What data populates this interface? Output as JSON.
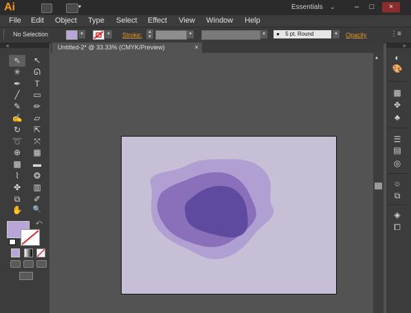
{
  "app": {
    "logo": "Ai",
    "workspace": "Essentials"
  },
  "menu": [
    "File",
    "Edit",
    "Object",
    "Type",
    "Select",
    "Effect",
    "View",
    "Window",
    "Help"
  ],
  "control": {
    "selection": "No Selection",
    "stroke_label": "Stroke:",
    "brush": "5 pt. Round",
    "opacity_label": "Opacity"
  },
  "document": {
    "tab_title": "Untitled-2* @ 33.33% (CMYK/Preview)",
    "close": "×"
  },
  "window_buttons": {
    "minimize": "–",
    "maximize": "□",
    "close": "×"
  },
  "colors": {
    "accent": "#e69b2a",
    "fill_swatch": "#b8a6d9",
    "artboard": "#c7bfd6",
    "shape_outer": "#b09fd3",
    "shape_mid": "#8a6fbb",
    "shape_inner": "#5e4a9e"
  },
  "icons": {
    "tools": [
      "selection-tool",
      "direct-selection-tool",
      "magic-wand-tool",
      "lasso-tool",
      "pen-tool",
      "type-tool",
      "line-tool",
      "rectangle-tool",
      "paintbrush-tool",
      "pencil-tool",
      "blob-brush-tool",
      "eraser-tool",
      "rotate-tool",
      "scale-tool",
      "warp-tool",
      "free-transform-tool",
      "shape-builder-tool",
      "perspective-grid-tool",
      "mesh-tool",
      "gradient-tool",
      "eyedropper-tool",
      "blend-tool",
      "symbol-sprayer-tool",
      "column-graph-tool",
      "artboard-tool",
      "slice-tool",
      "hand-tool",
      "zoom-tool"
    ],
    "right_panels": [
      "color-panel-icon",
      "color-guide-icon",
      "swatches-icon",
      "brushes-icon",
      "symbols-icon",
      "stroke-icon",
      "gradient-icon",
      "transparency-icon",
      "appearance-icon",
      "graphic-styles-icon",
      "layers-icon",
      "artboards-icon"
    ]
  }
}
